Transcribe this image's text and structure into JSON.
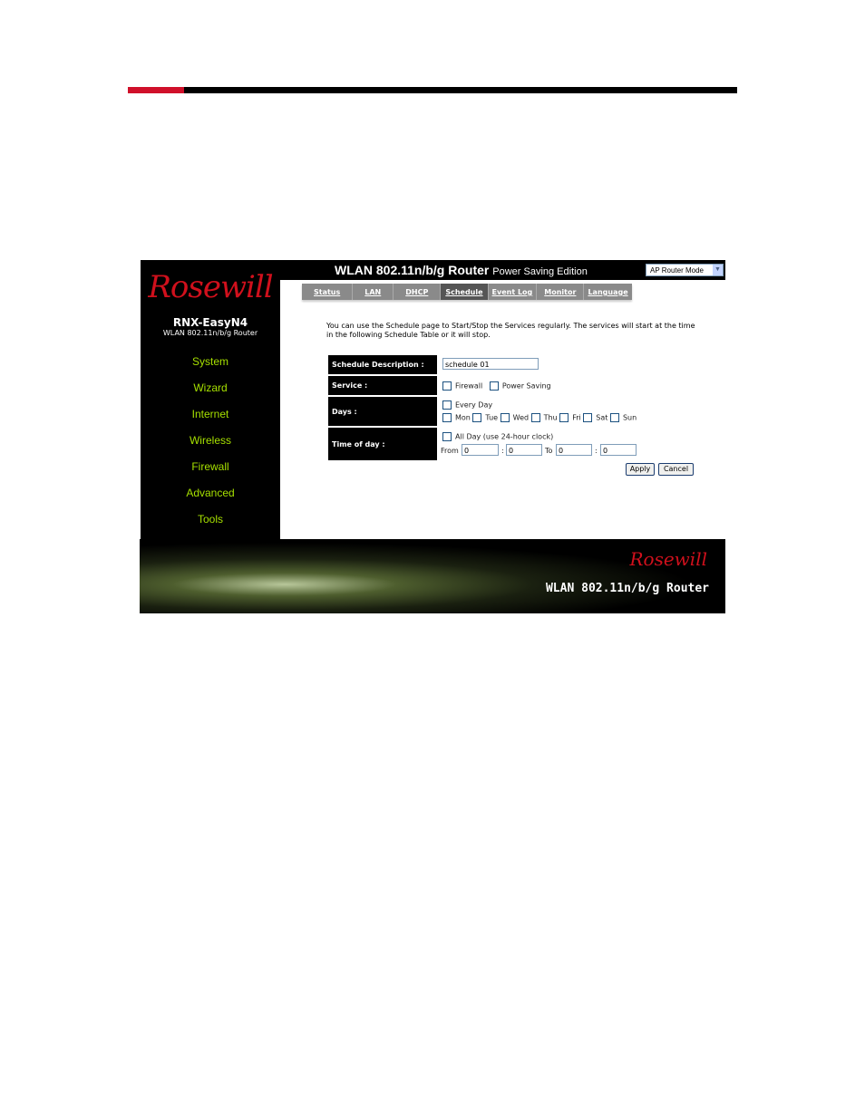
{
  "brand": {
    "logo": "Rosewill",
    "model": "RNX-EasyN4",
    "model_sub": "WLAN 802.11n/b/g Router"
  },
  "header": {
    "title": "WLAN 802.11n/b/g Router",
    "edition": "Power Saving Edition",
    "mode_select": "AP Router Mode"
  },
  "nav": [
    "System",
    "Wizard",
    "Internet",
    "Wireless",
    "Firewall",
    "Advanced",
    "Tools"
  ],
  "tabs": [
    {
      "label": "Status"
    },
    {
      "label": "LAN"
    },
    {
      "label": "DHCP"
    },
    {
      "label": "Schedule",
      "active": true
    },
    {
      "label": "Event Log"
    },
    {
      "label": "Monitor"
    },
    {
      "label": "Language"
    }
  ],
  "intro": "You can use the Schedule page to Start/Stop the Services regularly. The services will start at the time in the following Schedule Table or it will stop.",
  "form": {
    "desc_label": "Schedule Description :",
    "desc_value": "schedule 01",
    "service_label": "Service :",
    "services": [
      "Firewall",
      "Power Saving"
    ],
    "days_label": "Days :",
    "every_day": "Every Day",
    "days": [
      "Mon",
      "Tue",
      "Wed",
      "Thu",
      "Fri",
      "Sat",
      "Sun"
    ],
    "time_label": "Time of day :",
    "all_day": "All Day (use 24-hour clock)",
    "from_label": "From",
    "to_label": "To",
    "colon": ":",
    "from_h": "0",
    "from_m": "0",
    "to_h": "0",
    "to_m": "0",
    "apply": "Apply",
    "cancel": "Cancel"
  },
  "footer": {
    "logo": "Rosewill",
    "title": "WLAN 802.11n/b/g Router"
  },
  "colors": {
    "accent_red": "#d0102a",
    "nav_green": "#a6e000"
  }
}
